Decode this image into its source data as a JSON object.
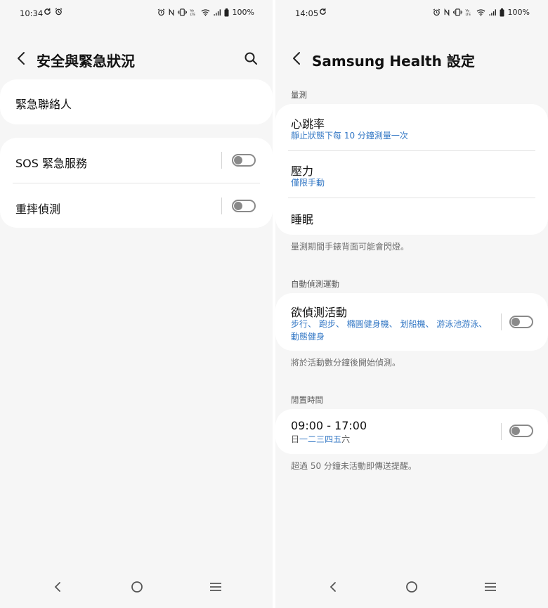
{
  "left": {
    "status": {
      "time": "10:34",
      "battery": "100%"
    },
    "title": "安全與緊急狀況",
    "emergency_contacts": "緊急聯絡人",
    "sos": {
      "label": "SOS 緊急服務",
      "enabled": false
    },
    "fall_detection": {
      "label": "重摔偵測",
      "enabled": false
    }
  },
  "right": {
    "status": {
      "time": "14:05",
      "battery": "100%"
    },
    "title": "Samsung Health 設定",
    "measure": {
      "header": "量測",
      "heart_rate": {
        "label": "心跳率",
        "sub": "靜止狀態下每 10 分鐘測量一次"
      },
      "stress": {
        "label": "壓力",
        "sub": "僅限手動"
      },
      "sleep": {
        "label": "睡眠"
      },
      "note": "量測期間手錶背面可能會閃燈。"
    },
    "auto_detect": {
      "header": "自動偵測運動",
      "activities": {
        "label": "欲偵測活動",
        "sub_line1": "步行、 跑步、 橢圓健身機、 划船機、 游泳池游泳、",
        "sub_line2": "動態健身",
        "enabled": false
      },
      "note": "將於活動數分鐘後開始偵測。"
    },
    "idle": {
      "header": "閒置時間",
      "time_range": "09:00 - 17:00",
      "days": {
        "sun": "日",
        "mon": "一",
        "tue": "二",
        "wed": "三",
        "thu": "四",
        "fri": "五",
        "sat": "六"
      },
      "enabled": false,
      "note": "超過 50 分鐘未活動即傳送提醒。"
    }
  },
  "colors": {
    "accent": "#3478c5",
    "background": "#f6f6f6",
    "card": "#ffffff",
    "toggle_off": "#8a8a8a"
  }
}
